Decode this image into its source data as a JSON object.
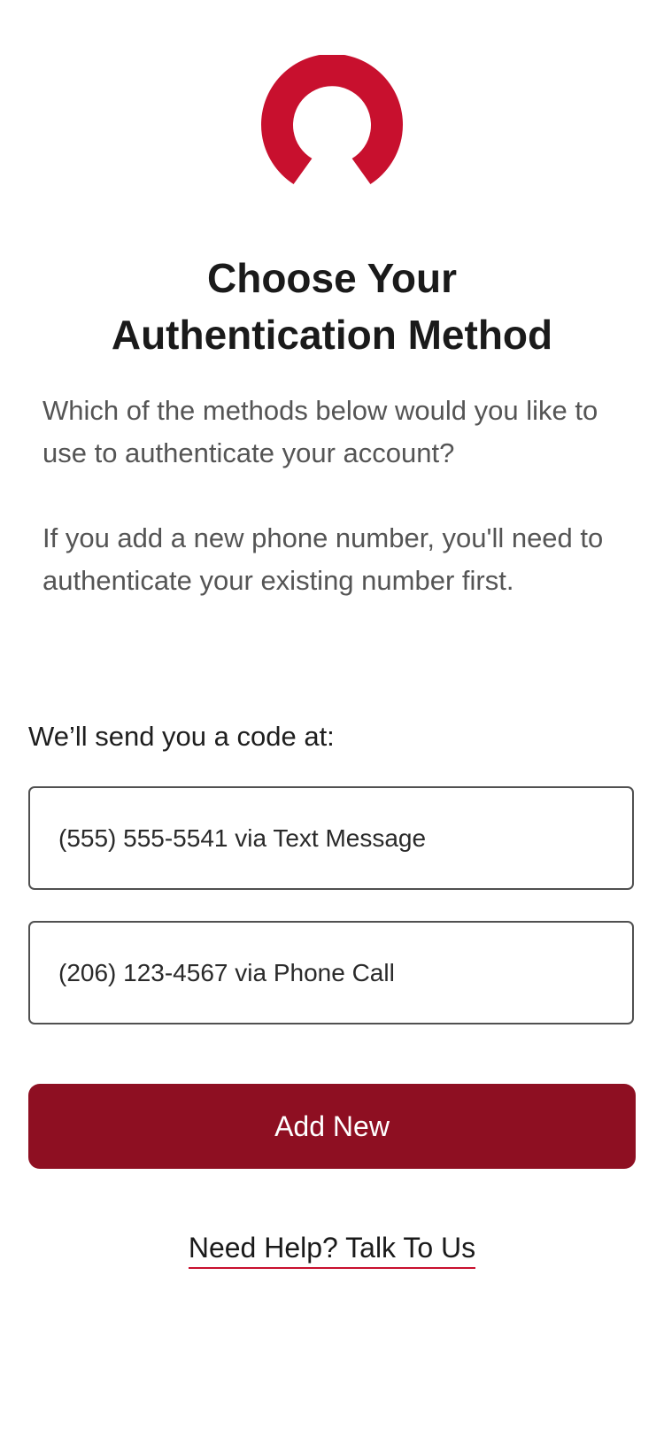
{
  "colors": {
    "brand_red": "#c8102e",
    "button_dark_red": "#8e0f22",
    "text_dark": "#1a1a1a",
    "text_muted": "#555555"
  },
  "logo": {
    "icon": "brand-arc-logo-icon"
  },
  "heading": {
    "line1": "Choose Your",
    "line2": "Authentication Method"
  },
  "description": {
    "paragraph1": "Which of the methods below would you like to use to authenticate your account?",
    "paragraph2": "If you add a new phone number, you'll need to authenticate your existing number first."
  },
  "send_section": {
    "label": "We’ll send you a code at:",
    "options": [
      {
        "label": "(555) 555-5541 via Text Message"
      },
      {
        "label": "(206) 123-4567 via Phone Call"
      }
    ]
  },
  "actions": {
    "add_new_label": "Add New"
  },
  "help": {
    "link_text": "Need Help? Talk To Us"
  }
}
